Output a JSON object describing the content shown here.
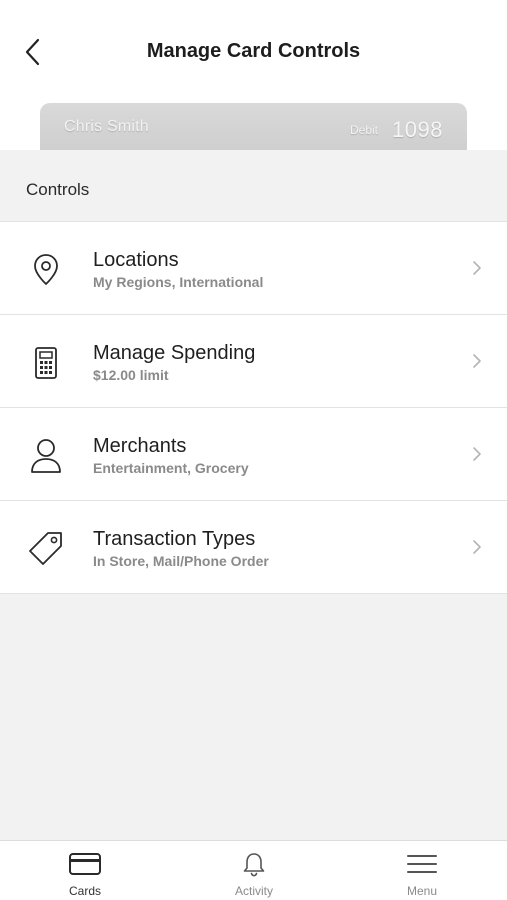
{
  "header": {
    "title": "Manage Card Controls",
    "back_icon": "chevron-left-icon"
  },
  "card": {
    "holder_name": "Chris Smith",
    "card_type": "Debit",
    "last_four": "1098"
  },
  "controls": {
    "section_label": "Controls",
    "items": [
      {
        "icon": "location-pin-icon",
        "title": "Locations",
        "subtitle": "My Regions, International"
      },
      {
        "icon": "calculator-icon",
        "title": "Manage Spending",
        "subtitle": "$12.00 limit"
      },
      {
        "icon": "person-icon",
        "title": "Merchants",
        "subtitle": "Entertainment, Grocery"
      },
      {
        "icon": "tag-icon",
        "title": "Transaction Types",
        "subtitle": "In Store, Mail/Phone Order"
      }
    ]
  },
  "tabbar": {
    "tabs": [
      {
        "icon": "credit-card-icon",
        "label": "Cards",
        "active": true
      },
      {
        "icon": "bell-icon",
        "label": "Activity",
        "active": false
      },
      {
        "icon": "hamburger-menu-icon",
        "label": "Menu",
        "active": false
      }
    ]
  },
  "colors": {
    "background": "#f2f2f2",
    "surface": "#ffffff",
    "text_primary": "#1f1f1f",
    "text_secondary": "#8a8a8a",
    "card_silver": "#d4d4d4"
  }
}
